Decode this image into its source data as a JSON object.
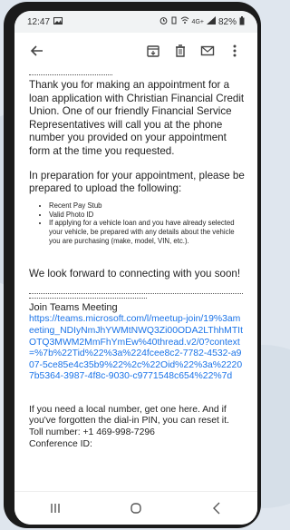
{
  "status": {
    "time": "12:47",
    "battery": "82%",
    "network": "4G+"
  },
  "toolbar": {
    "back_icon": "arrow-back-icon",
    "icons": [
      "archive-icon",
      "delete-icon",
      "mail-icon",
      "more-icon"
    ]
  },
  "email": {
    "paragraph1": "Thank you for making an appointment for a loan application with Christian Financial Credit Union. One of our friendly Financial Service Representatives will call you at the phone number you provided on your appointment form at the time you requested.",
    "paragraph2": "In preparation for your appointment, please be prepared to upload the following:",
    "bullets": [
      "Recent Pay Stub",
      "Valid Photo ID",
      "If applying for a vehicle loan and you have already selected your vehicle, be prepared with any details about the vehicle you are purchasing (make, model, VIN, etc.)."
    ],
    "closing": "We look forward to connecting with you soon!",
    "teams_title": "Join Teams Meeting",
    "teams_link": "https://teams.microsoft.com/l/meetup-join/19%3ameeting_NDIyNmJhYWMtNWQ3Zi00ODA2LThhMTItOTQ3MWM2MmFhYmEw%40thread.v2/0?context=%7b%22Tid%22%3a%224fcee8c2-7782-4532-a907-5ce85e4c35b9%22%2c%22Oid%22%3a%22207b5364-3987-4f8c-9030-c9771548c654%22%7d",
    "local_number_text": "If you need a local number, get one here. And if you've forgotten the dial-in PIN, you can reset it.",
    "toll_number": "Toll number: +1 469-998-7296",
    "conference_id": "Conference ID:"
  },
  "navbar": {
    "icons": [
      "recent-apps-icon",
      "home-icon",
      "back-icon"
    ]
  }
}
